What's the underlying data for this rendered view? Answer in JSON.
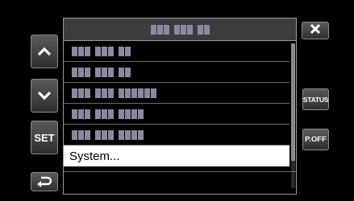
{
  "panel": {
    "title": "",
    "items": [
      {
        "label": "",
        "selected": false
      },
      {
        "label": "",
        "selected": false
      },
      {
        "label": "",
        "selected": false
      },
      {
        "label": "",
        "selected": false
      },
      {
        "label": "",
        "selected": false
      },
      {
        "label": "System...",
        "selected": true
      }
    ]
  },
  "buttons": {
    "set": "SET",
    "status": "STATUS",
    "power_off": "P.OFF"
  },
  "icons": {
    "up": "chevron-up-icon",
    "down": "chevron-down-icon",
    "back": "return-arrow-icon",
    "close": "close-icon"
  },
  "scrollbar": {
    "position": 0.0,
    "visible_fraction": 0.81
  },
  "colors": {
    "background": "#000000",
    "button": "#444444",
    "selected_row": "#ffffff"
  }
}
